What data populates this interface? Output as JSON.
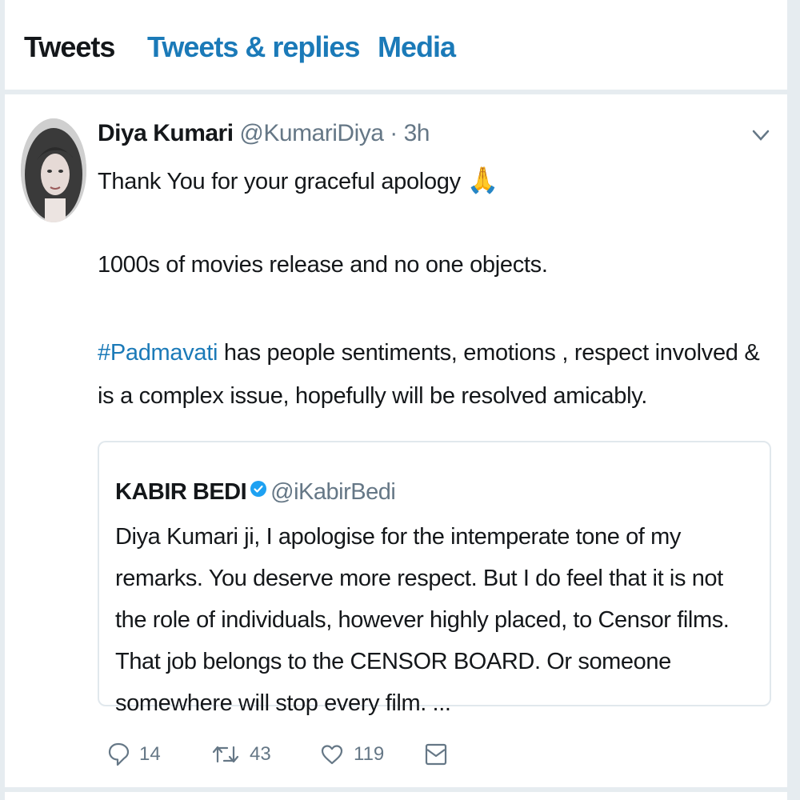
{
  "tabs": [
    {
      "label": "Tweets",
      "active": true
    },
    {
      "label": "Tweets & replies",
      "active": false
    },
    {
      "label": "Media",
      "active": false
    }
  ],
  "tweet": {
    "author": {
      "name": "Diya Kumari",
      "handle": "@KumariDiya",
      "separator": "·",
      "time": "3h"
    },
    "text": {
      "line1": "Thank You for your graceful apology",
      "line1_emoji": "🙏",
      "para2": "1000s of movies release and no one objects.",
      "hashtag": "#Padmavati",
      "para3_rest": " has people sentiments, emotions , respect involved & is a complex issue, hopefully will be resolved amicably."
    },
    "quoted": {
      "name": "KABIR BEDI",
      "handle": "@iKabirBedi",
      "text": "Diya Kumari ji, I apologise for the intemperate tone of my remarks. You deserve more respect. But I do feel that it is not the role of individuals, however highly placed, to Censor films. That job belongs to the CENSOR BOARD. Or someone somewhere will stop every film. ..."
    },
    "actions": {
      "reply_count": "14",
      "retweet_count": "43",
      "like_count": "119"
    }
  },
  "icons": {
    "reply": "reply-icon",
    "retweet": "retweet-icon",
    "like": "heart-icon",
    "dm": "envelope-icon",
    "caret": "chevron-down-icon",
    "verified": "verified-badge-icon"
  },
  "colors": {
    "link_blue": "#1b7ab8",
    "verified_blue": "#1da1f2",
    "muted_gray": "#657786",
    "text_dark": "#14171a",
    "divider": "#e6ecf0"
  }
}
